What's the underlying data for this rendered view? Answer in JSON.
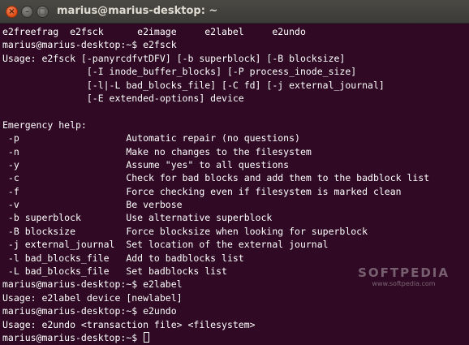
{
  "window": {
    "title": "marius@marius-desktop: ~",
    "close_glyph": "×",
    "minimize_glyph": "–",
    "maximize_glyph": "□"
  },
  "colors": {
    "terminal_background": "#300a24",
    "terminal_text": "#ffffff",
    "titlebar": "#3c3b37",
    "close_button": "#df4a16"
  },
  "icons": {
    "close": "close-icon",
    "minimize": "minimize-icon",
    "maximize": "maximize-icon"
  },
  "terminal": {
    "lines": [
      "e2freefrag  e2fsck      e2image     e2label     e2undo",
      "marius@marius-desktop:~$ e2fsck",
      "Usage: e2fsck [-panyrcdfvtDFV] [-b superblock] [-B blocksize]",
      "               [-I inode_buffer_blocks] [-P process_inode_size]",
      "               [-l|-L bad_blocks_file] [-C fd] [-j external_journal]",
      "               [-E extended-options] device",
      "",
      "Emergency help:",
      " -p                   Automatic repair (no questions)",
      " -n                   Make no changes to the filesystem",
      " -y                   Assume \"yes\" to all questions",
      " -c                   Check for bad blocks and add them to the badblock list",
      " -f                   Force checking even if filesystem is marked clean",
      " -v                   Be verbose",
      " -b superblock        Use alternative superblock",
      " -B blocksize         Force blocksize when looking for superblock",
      " -j external_journal  Set location of the external journal",
      " -l bad_blocks_file   Add to badblocks list",
      " -L bad_blocks_file   Set badblocks list",
      "marius@marius-desktop:~$ e2label",
      "Usage: e2label device [newlabel]",
      "marius@marius-desktop:~$ e2undo",
      "Usage: e2undo <transaction file> <filesystem>"
    ],
    "prompt": "marius@marius-desktop:~$ "
  },
  "watermark": {
    "logo": "SOFTPEDIA",
    "url": "www.softpedia.com"
  }
}
